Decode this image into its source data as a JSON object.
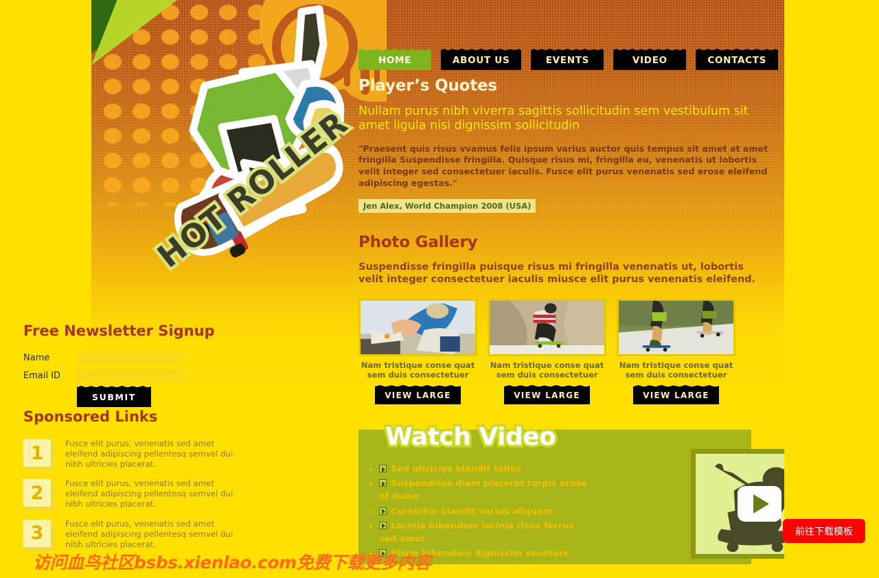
{
  "site": {
    "logo_text": "HOT ROLLER"
  },
  "nav": {
    "items": [
      {
        "label": "HOME",
        "active": true
      },
      {
        "label": "ABOUT US",
        "active": false
      },
      {
        "label": "EVENTS",
        "active": false
      },
      {
        "label": "VIDEO",
        "active": false
      },
      {
        "label": "CONTACTS",
        "active": false
      }
    ]
  },
  "quotes": {
    "heading": "Player’s Quotes",
    "lead": "Nullam purus nibh viverra sagittis sollicitudin sem vestibulum sit amet ligula nisi dignissim sollicitudin",
    "body": "\"Praesent quis risus vvamus felis ipsum varius auctor quis tempus sit amet at amet fringilla Suspendisse fringilla. Quisque risus mi, fringilla eu, venenatis ut lobortis velit integer sed consectetuer iaculis. Fusce elit purus venenatis sed erose eleifend adipiscing egestas.\"",
    "attribution": "Jen Alex, World Champion 2008 (USA)"
  },
  "gallery": {
    "heading": "Photo Gallery",
    "lead": "Suspendisse fringilla puisque risus mi fringilla venenatis ut, lobortis velit integer consectetuer iaculis miusce elit purus venenatis eleifend.",
    "items": [
      {
        "caption": "Nam tristique conse quat sem duis consectetuer",
        "button": "VIEW LARGE"
      },
      {
        "caption": "Nam tristique conse quat sem duis consectetuer",
        "button": "VIEW LARGE"
      },
      {
        "caption": "Nam tristique conse quat sem duis consectetuer",
        "button": "VIEW LARGE"
      }
    ]
  },
  "watch_video": {
    "heading": "Watch Video",
    "links": [
      "Sed ultricies blandit tellus",
      "Suspendisse diam placerat turpis erose of duise",
      "Curabitur blandit varius aliquam",
      "Lacinia bibendum lacinia risus ferrus sed amet",
      "Etiam bibendum dignissim senetore"
    ]
  },
  "newsletter": {
    "heading": "Free Newsletter Signup",
    "name_label": "Name",
    "name_value": "",
    "name_placeholder": "",
    "email_label": "Email ID",
    "email_value": "",
    "email_placeholder": "",
    "submit_label": "SUBMIT"
  },
  "sponsored": {
    "heading": "Sponsored Links",
    "items": [
      {
        "number": "1",
        "text": "Fusce elit purus, venenatis sed amet eleifend adipiscing pellentesq semvel dui nibh ultricies placerat."
      },
      {
        "number": "2",
        "text": "Fusce elit purus, venenatis sed amet eleifend adipiscing pellentesq semvel dui nibh ultricies placerat."
      },
      {
        "number": "3",
        "text": "Fusce elit purus, venenatis sed amet eleifend adipiscing pellentesq semvel dui nibh ultricies placerat."
      }
    ]
  },
  "overlay": {
    "watermark": "访问血鸟社区bsbs.xienlao.com免费下载更多内容",
    "download_button": "前往下载模板"
  },
  "colors": {
    "page_bg": "#FFE000",
    "header_top": "#B7511F",
    "accent_green": "#7DB51F",
    "heading_red": "#A8341D",
    "lead_yellow": "#FBE800",
    "watch_bg": "#A8B518",
    "download_red": "#FF0000"
  }
}
